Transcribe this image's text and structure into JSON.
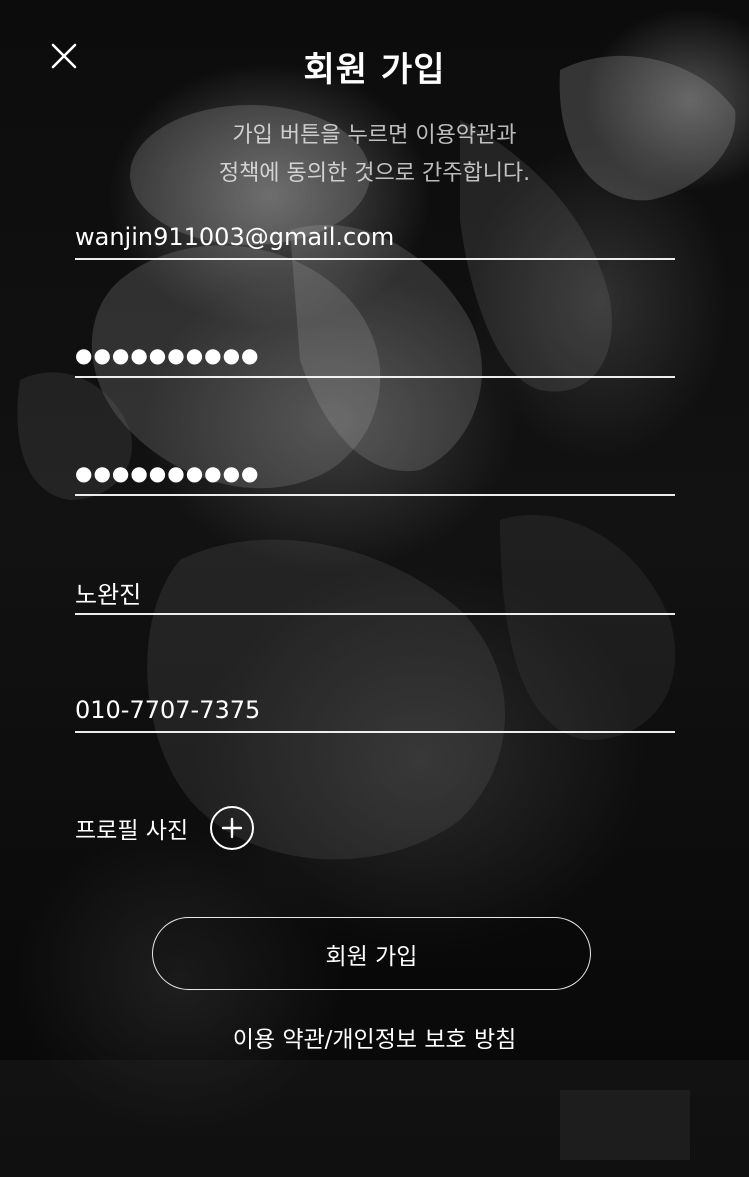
{
  "header": {
    "title": "회원 가입",
    "close_icon": "close-icon"
  },
  "notice": {
    "line1": "가입 버튼을 누르면 이용약관과",
    "line2": "정책에 동의한 것으로 간주합니다."
  },
  "form": {
    "email": {
      "value": "wanjin911003@gmail.com"
    },
    "password": {
      "value": "●●●●●●●●●●"
    },
    "password_confirm": {
      "value": "●●●●●●●●●●"
    },
    "name": {
      "value": "노완진"
    },
    "phone": {
      "value": "010-7707-7375"
    }
  },
  "profile": {
    "label": "프로필 사진",
    "add_icon": "plus-circle-icon"
  },
  "actions": {
    "signup_label": "회원 가입",
    "terms_link": "이용 약관/개인정보 보호 방침"
  },
  "colors": {
    "background": "#000000",
    "text": "#ffffff",
    "subtle_text": "#b8b8b8"
  }
}
